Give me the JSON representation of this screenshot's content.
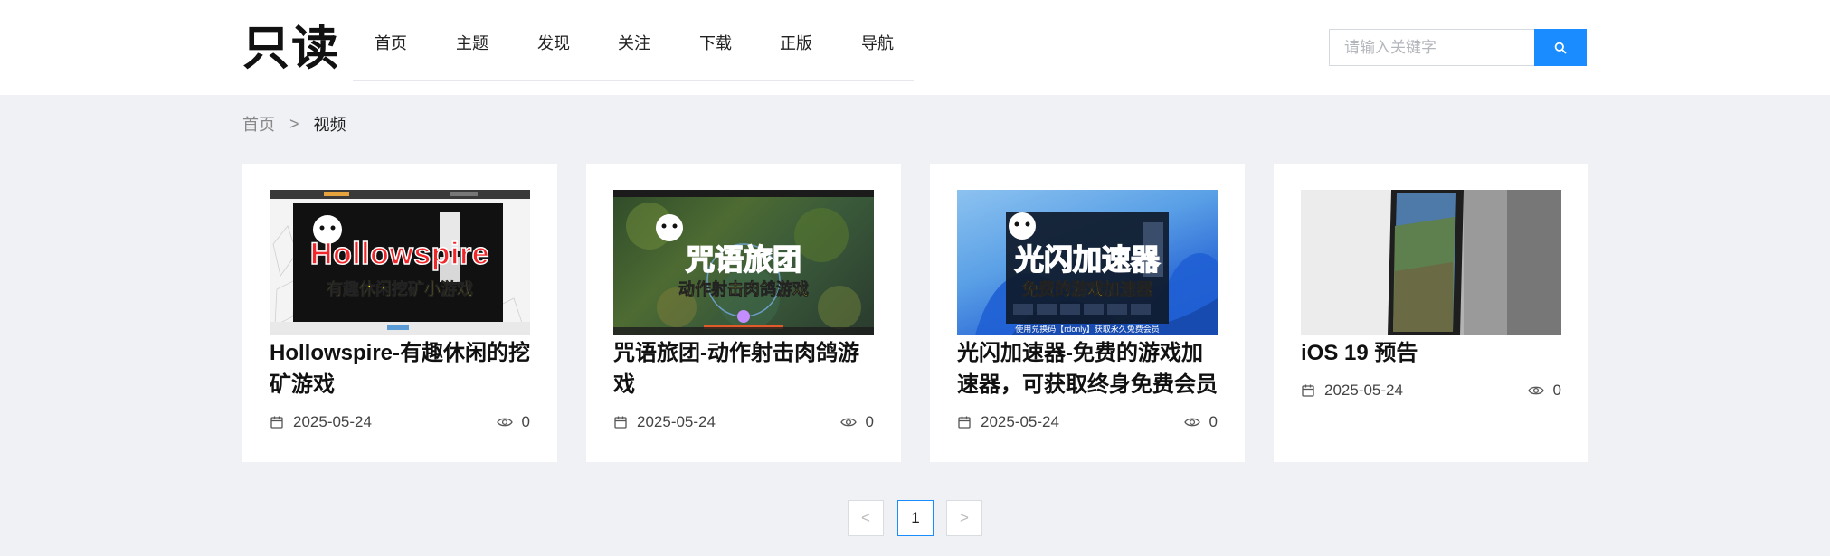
{
  "header": {
    "logo": "只读",
    "nav": [
      "首页",
      "主题",
      "发现",
      "关注",
      "下载",
      "正版",
      "导航"
    ],
    "search_placeholder": "请输入关键字"
  },
  "breadcrumb": {
    "home": "首页",
    "separator": ">",
    "current": "视频"
  },
  "cards": [
    {
      "title": "Hollowspire-有趣休闲的挖矿游戏",
      "date": "2025-05-24",
      "views": "0",
      "thumb_title": "Hollowspire",
      "thumb_subtitle": "有趣休闲挖矿小游戏"
    },
    {
      "title": "咒语旅团-动作射击肉鸽游戏",
      "date": "2025-05-24",
      "views": "0",
      "thumb_title": "咒语旅团",
      "thumb_subtitle": "动作射击肉鸽游戏"
    },
    {
      "title": "光闪加速器-免费的游戏加速器，可获取终身免费会员",
      "date": "2025-05-24",
      "views": "0",
      "thumb_title": "光闪加速器",
      "thumb_subtitle": "免费的游戏加速器",
      "thumb_caption": "使用兑换码【rdonly】获取永久免费会员"
    },
    {
      "title": "iOS 19 预告",
      "date": "2025-05-24",
      "views": "0"
    }
  ],
  "pagination": {
    "prev": "<",
    "current": "1",
    "next": ">"
  },
  "colors": {
    "accent": "#1a8cff",
    "background": "#eff1f5",
    "card": "#ffffff"
  }
}
